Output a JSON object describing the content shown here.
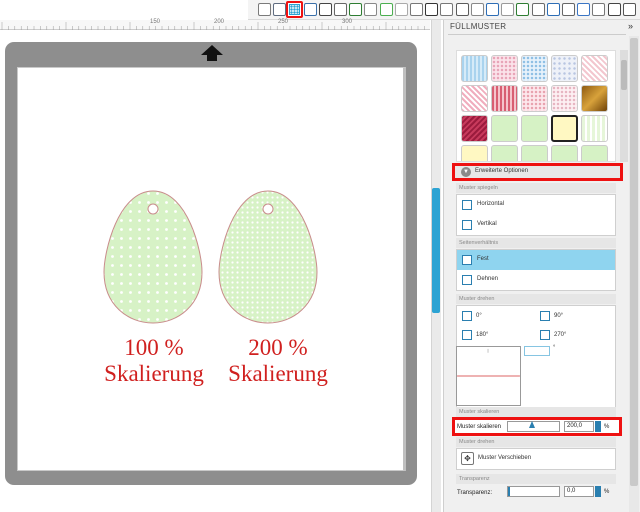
{
  "ruler": {
    "labels": [
      "150",
      "200",
      "250",
      "300"
    ]
  },
  "toolbar": {
    "icons": [
      "eraser-icon",
      "panel-icon",
      "fill-pattern-icon",
      "shape-icon",
      "pentagon-icon",
      "offset-icon",
      "trace-icon",
      "trace-fill-icon",
      "line-style-icon",
      "grid-icon",
      "align-icon",
      "text-icon",
      "weld-icon",
      "replicate-icon",
      "transform-icon",
      "nest-icon",
      "color-icon",
      "fill-icon",
      "cut-settings-icon",
      "send-icon",
      "library-icon",
      "store-icon",
      "design-icon",
      "settings-icon",
      "arrow-icon"
    ],
    "active_icon": "fill-pattern-icon",
    "accent": "#2ca3d3",
    "highlight": "#ee1111"
  },
  "canvas": {
    "up_arrow_icon": "up-arrow-icon",
    "captions": [
      {
        "line1": "100 %",
        "line2": "Skalierung"
      },
      {
        "line1": "200 %",
        "line2": "Skalierung"
      }
    ],
    "caption_color": "#d0201f",
    "egg_fill": "#d7f2c6",
    "egg_outline": "#c98c8c"
  },
  "panel": {
    "title": "FÜLLMUSTER",
    "close_icon": "»",
    "advanced_options": "Erweiterte Optionen",
    "sections": {
      "mirror": {
        "title": "Muster spiegeln",
        "options": [
          "Horizontal",
          "Vertikal"
        ]
      },
      "aspect": {
        "title": "Seitenverhältnis",
        "options": [
          "Fest",
          "Dehnen"
        ],
        "selected": "Fest"
      },
      "rotate": {
        "title": "Muster drehen",
        "options": [
          "0°",
          "90°",
          "180°",
          "270°"
        ],
        "angle_unit": "°"
      },
      "scale": {
        "title": "Muster skalieren",
        "label": "Muster skalieren",
        "value": "200,0",
        "unit": "%"
      },
      "move": {
        "title": "Muster drehen",
        "button": "Muster Verschieben"
      },
      "transparency": {
        "title": "Transparenz",
        "label": "Transparenz:",
        "value": "0,0",
        "unit": "%"
      }
    }
  }
}
